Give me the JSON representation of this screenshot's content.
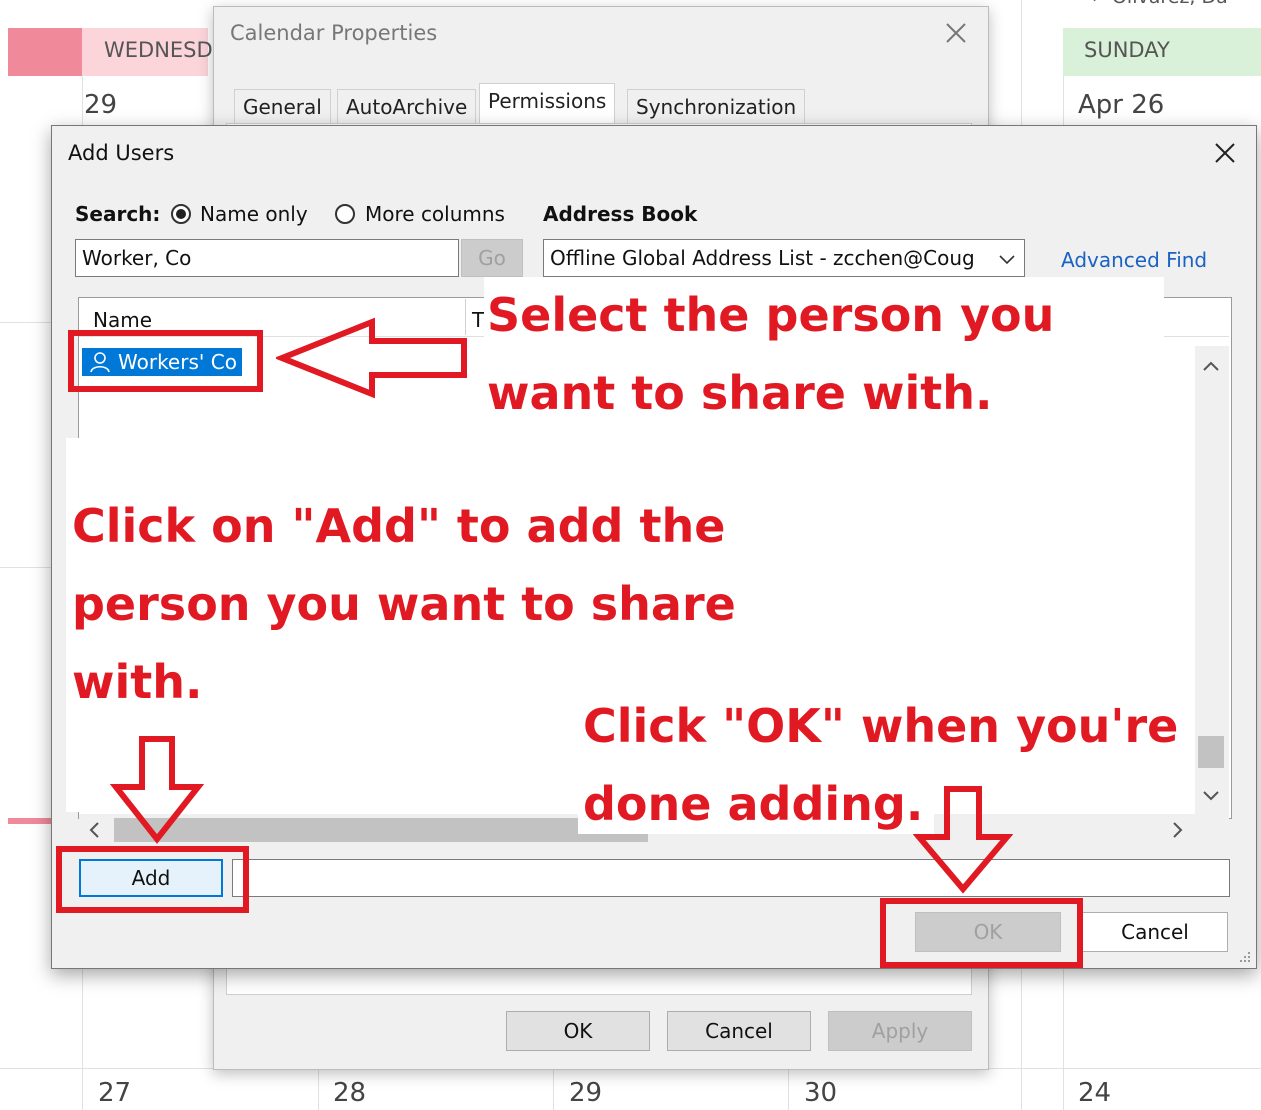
{
  "calendar": {
    "top_wed_label": "WEDNESD",
    "top_wed_num": "29",
    "sunday_label": "SUNDAY",
    "sunday_num": "Apr 26",
    "sunday_top_partial": "← Olivarez, Da",
    "bottom_nums": [
      "27",
      "28",
      "29",
      "30",
      "24"
    ],
    "wed_header_color": "#fbd5da",
    "wed_stripe_color": "#f08a9a",
    "sunday_header_color": "#d9f1d9"
  },
  "cal_props": {
    "title": "Calendar Properties",
    "tabs": [
      "General",
      "AutoArchive",
      "Permissions",
      "Synchronization"
    ],
    "ok": "OK",
    "cancel": "Cancel",
    "apply": "Apply"
  },
  "add_users": {
    "title": "Add Users",
    "search_label": "Search:",
    "opt_name_only": "Name only",
    "opt_more_columns": "More columns",
    "address_book_label": "Address Book",
    "search_value": "Worker, Co",
    "go": "Go",
    "address_book_value": "Offline Global Address List - zcchen@Coug",
    "advanced_find": "Advanced Find",
    "col_name": "Name",
    "col_title_partial": "T",
    "selected_item": "Workers' Co",
    "add": "Add",
    "ok": "OK",
    "cancel": "Cancel"
  },
  "annotations": {
    "select_line1": "Select the person you",
    "select_line2": "want to share with.",
    "click_add_line1": "Click on \"Add\" to add the",
    "click_add_line2": "person you want to share",
    "click_add_line3": "with.",
    "click_ok_line1": "Click \"OK\" when you're",
    "click_ok_line2": "done adding.",
    "color": "#e01922"
  },
  "icons": {
    "close": "close-icon",
    "person": "person-icon",
    "dropdown": "chevron-down-icon",
    "arrows": "arrow-icon"
  }
}
